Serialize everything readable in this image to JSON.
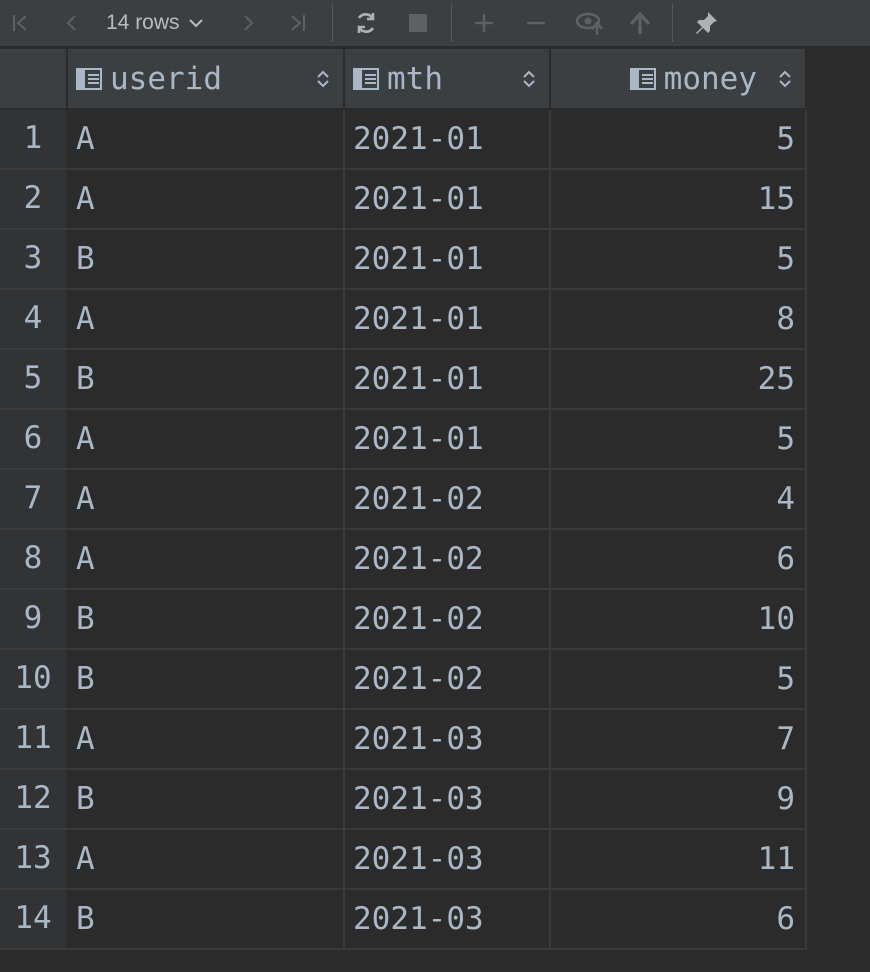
{
  "toolbar": {
    "rows_label": "14 rows",
    "icons": [
      "first-page-icon",
      "prev-page-icon",
      "chevron-down-icon",
      "next-page-icon",
      "last-page-icon",
      "refresh-icon",
      "stop-icon",
      "add-row-icon",
      "delete-row-icon",
      "view-icon",
      "submit-icon",
      "pin-icon"
    ]
  },
  "colors": {
    "toolbar_bg": "#3c3f41",
    "grid_bg": "#2b2b2b",
    "rownum_bg": "#313335",
    "text": "#a9b7c6"
  },
  "table": {
    "columns": [
      "userid",
      "mth",
      "money"
    ],
    "rows": [
      {
        "n": "1",
        "userid": "A",
        "mth": "2021-01",
        "money": "5"
      },
      {
        "n": "2",
        "userid": "A",
        "mth": "2021-01",
        "money": "15"
      },
      {
        "n": "3",
        "userid": "B",
        "mth": "2021-01",
        "money": "5"
      },
      {
        "n": "4",
        "userid": "A",
        "mth": "2021-01",
        "money": "8"
      },
      {
        "n": "5",
        "userid": "B",
        "mth": "2021-01",
        "money": "25"
      },
      {
        "n": "6",
        "userid": "A",
        "mth": "2021-01",
        "money": "5"
      },
      {
        "n": "7",
        "userid": "A",
        "mth": "2021-02",
        "money": "4"
      },
      {
        "n": "8",
        "userid": "A",
        "mth": "2021-02",
        "money": "6"
      },
      {
        "n": "9",
        "userid": "B",
        "mth": "2021-02",
        "money": "10"
      },
      {
        "n": "10",
        "userid": "B",
        "mth": "2021-02",
        "money": "5"
      },
      {
        "n": "11",
        "userid": "A",
        "mth": "2021-03",
        "money": "7"
      },
      {
        "n": "12",
        "userid": "B",
        "mth": "2021-03",
        "money": "9"
      },
      {
        "n": "13",
        "userid": "A",
        "mth": "2021-03",
        "money": "11"
      },
      {
        "n": "14",
        "userid": "B",
        "mth": "2021-03",
        "money": "6"
      }
    ]
  }
}
